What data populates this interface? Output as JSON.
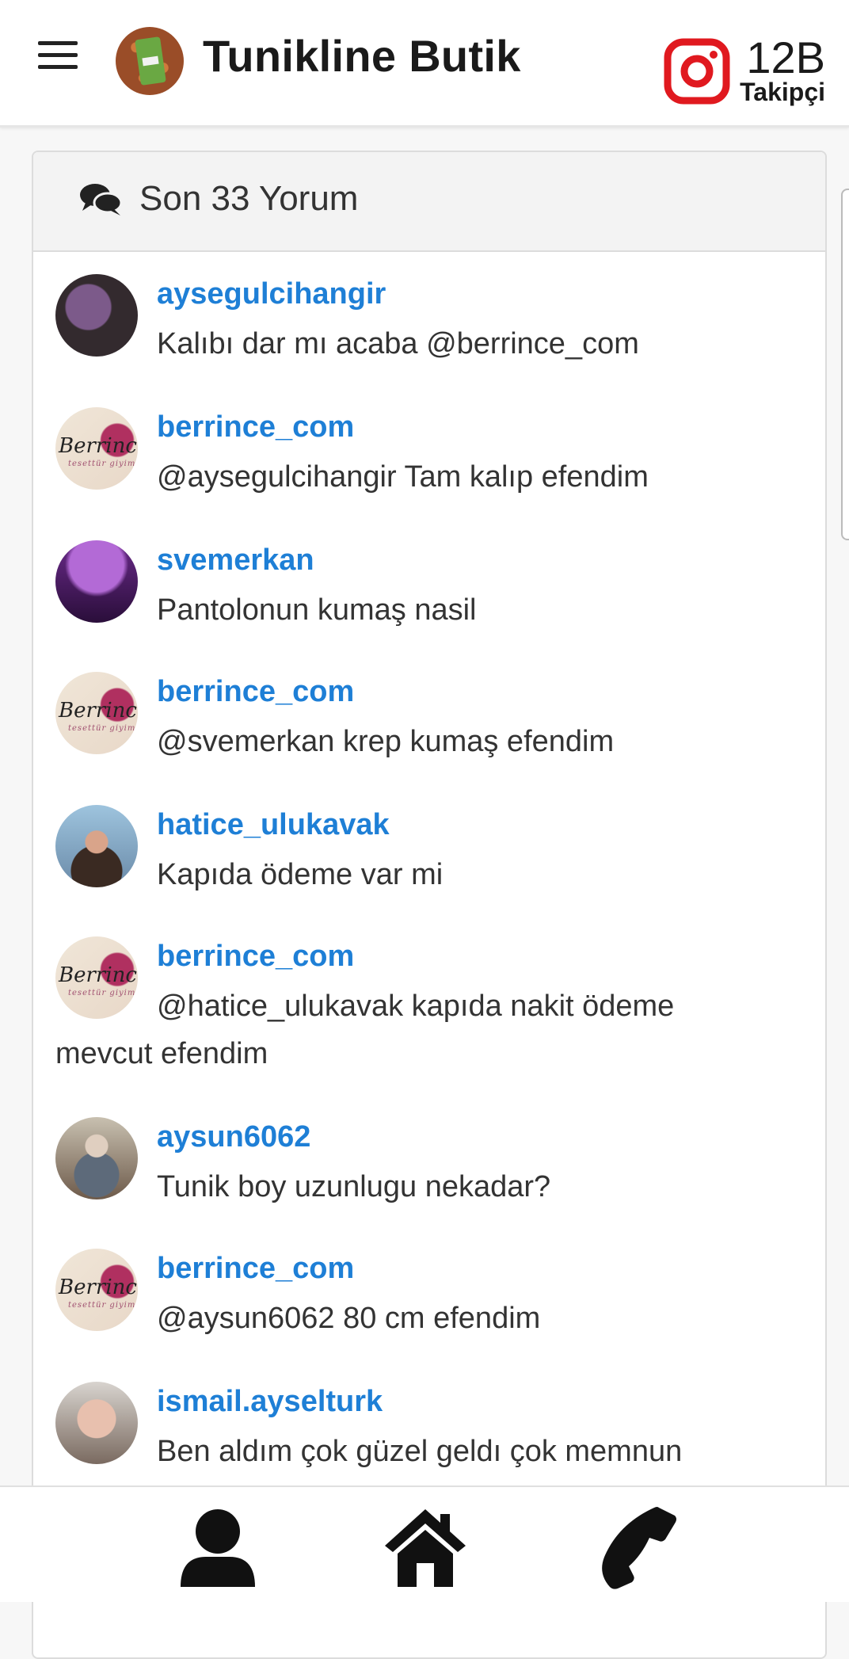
{
  "header": {
    "title": "Tunikline Butik",
    "followers_count": "12B",
    "followers_label": "Takipçi",
    "icons": {
      "menu": "menu-icon",
      "logo": "shop-logo",
      "instagram": "instagram-icon"
    },
    "instagram_color": "#e0191f"
  },
  "comments_card": {
    "title": "Son 33 Yorum",
    "icon": "comments-icon",
    "link_color": "#1e7fd6",
    "items": [
      {
        "username": "aysegulcihangir",
        "text": "Kalıbı dar mı acaba @berrince_com"
      },
      {
        "username": "berrince_com",
        "text": "@aysegulcihangir Tam kalıp efendim"
      },
      {
        "username": "svemerkan",
        "text": "Pantolonun kumaş nasil"
      },
      {
        "username": "berrince_com",
        "text": "@svemerkan krep kumaş efendim"
      },
      {
        "username": "hatice_ulukavak",
        "text": "Kapıda ödeme var mi"
      },
      {
        "username": "berrince_com",
        "text": "@hatice_ulukavak kapıda nakit ödeme mevcut efendim"
      },
      {
        "username": "aysun6062",
        "text": "Tunik boy uzunlugu nekadar?"
      },
      {
        "username": "berrince_com",
        "text": "@aysun6062 80 cm efendim"
      },
      {
        "username": "ismail.ayselturk",
        "text": "Ben aldım çok güzel geldı çok memnun"
      }
    ],
    "brand_avatar": {
      "script": "Berrince",
      "sub": "tesettür giyim"
    }
  },
  "bottom_nav": {
    "items": [
      {
        "icon": "user-icon"
      },
      {
        "icon": "home-icon"
      },
      {
        "icon": "phone-icon"
      }
    ]
  }
}
